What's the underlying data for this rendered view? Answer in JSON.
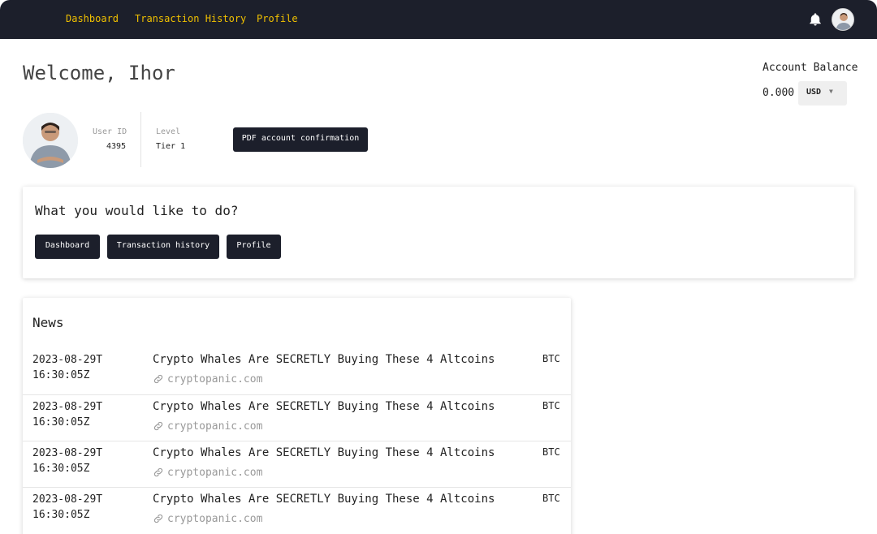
{
  "nav": {
    "links": [
      "Dashboard",
      "Transaction History",
      "Profile"
    ]
  },
  "header": {
    "welcome": "Welcome, Ihor"
  },
  "balance": {
    "label": "Account Balance",
    "value": "0.000",
    "currency": "USD"
  },
  "profile": {
    "user_id_label": "User ID",
    "user_id": "4395",
    "level_label": "Level",
    "level": "Tier 1",
    "pdf_button": "PDF account confirmation"
  },
  "actions": {
    "title": "What you would like to do?",
    "buttons": [
      "Dashboard",
      "Transaction history",
      "Profile"
    ]
  },
  "news": {
    "title": "News",
    "items": [
      {
        "date": "2023-08-29T",
        "time": "16:30:05Z",
        "headline": "Crypto Whales Are SECRETLY Buying These 4 Altcoins",
        "source": "cryptopanic.com",
        "tag": "BTC"
      },
      {
        "date": "2023-08-29T",
        "time": "16:30:05Z",
        "headline": "Crypto Whales Are SECRETLY Buying These 4 Altcoins",
        "source": "cryptopanic.com",
        "tag": "BTC"
      },
      {
        "date": "2023-08-29T",
        "time": "16:30:05Z",
        "headline": "Crypto Whales Are SECRETLY Buying These 4 Altcoins",
        "source": "cryptopanic.com",
        "tag": "BTC"
      },
      {
        "date": "2023-08-29T",
        "time": "16:30:05Z",
        "headline": "Crypto Whales Are SECRETLY Buying These 4 Altcoins",
        "source": "cryptopanic.com",
        "tag": "BTC"
      }
    ]
  },
  "icons": {
    "bell": "bell-icon",
    "avatar": "user-avatar",
    "link": "link-icon",
    "caret": "caret-down-icon"
  },
  "colors": {
    "nav_bg": "#1c1f2b",
    "nav_link": "#f0c000",
    "button_bg": "#1c1f2b"
  }
}
